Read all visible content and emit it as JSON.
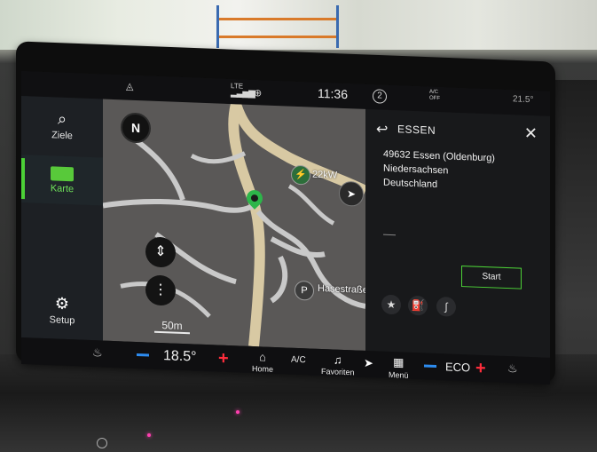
{
  "status_bar": {
    "time": "11:36",
    "network": "LTE",
    "notifications_count": "2",
    "ac_status": "A/C\nOFF",
    "outside_temp": "21.5°"
  },
  "rail": {
    "items": [
      {
        "label": "Ziele",
        "icon": "search-pin-icon",
        "active": false
      },
      {
        "label": "Karte",
        "icon": "map-icon",
        "active": true
      },
      {
        "label": "Setup",
        "icon": "gear-icon",
        "active": false
      }
    ]
  },
  "map": {
    "compass": "N",
    "scale": "50m",
    "poi_charger": "22kW",
    "poi_parking_letter": "P",
    "street": "Hasestraße"
  },
  "panel": {
    "title": "ESSEN",
    "address_line1": "49632 Essen (Oldenburg)",
    "address_line2": "Niedersachsen",
    "address_line3": "Deutschland",
    "start_label": "Start"
  },
  "bottom_bar": {
    "temperature": "18.5°",
    "home_label": "Home",
    "ac_label": "A/C",
    "favorites_label": "Favoriten",
    "menu_label": "Menü",
    "mode_label": "ECO"
  },
  "colors": {
    "accent_green": "#4cd137",
    "minus_blue": "#2d8cf0",
    "plus_red": "#ff2d3c",
    "map_road": "#d8c9a3",
    "map_street": "#c9c9c9"
  }
}
